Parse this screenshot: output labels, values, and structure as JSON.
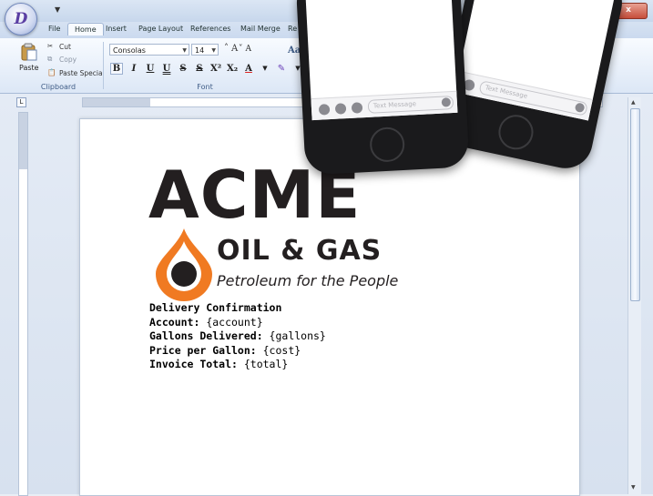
{
  "app": {
    "orb_letter": "D",
    "icon": "dx-logo-icon"
  },
  "window_controls": {
    "minimize": "–",
    "maximize": "□",
    "close": "x"
  },
  "tabs": [
    "File",
    "Home",
    "Insert",
    "Page Layout",
    "References",
    "Mail Merge",
    "Re"
  ],
  "ribbon": {
    "clipboard": {
      "paste": "Paste",
      "cut": "Cut",
      "copy": "Copy",
      "paste_special": "Paste Special",
      "label": "Clipboard"
    },
    "font": {
      "family": "Consolas",
      "size": "14",
      "grow": "A",
      "shrink": "A",
      "label": "Font",
      "buttons": [
        "B",
        "I",
        "U",
        "U",
        "S",
        "S",
        "X²",
        "X₂",
        "A"
      ]
    },
    "styles_hint": "Aa"
  },
  "document": {
    "logo_main": "ACME",
    "logo_sub": "OIL & GAS",
    "logo_tagline": "Petroleum for the People",
    "lines": [
      {
        "label": "Delivery Confirmation",
        "value": ""
      },
      {
        "label": "Account:",
        "value": " {account}"
      },
      {
        "label": "Gallons Delivered:",
        "value": " {gallons}"
      },
      {
        "label": "Price per Gallon:",
        "value": " {cost}"
      },
      {
        "label": "Invoice Total:",
        "value": " {total}"
      }
    ]
  },
  "phones": [
    {
      "placeholder": "Text Message"
    },
    {
      "placeholder": "Text Message"
    }
  ],
  "colors": {
    "accent": "#3f5c86",
    "logo_orange": "#f07a22",
    "logo_dark": "#231f20"
  }
}
